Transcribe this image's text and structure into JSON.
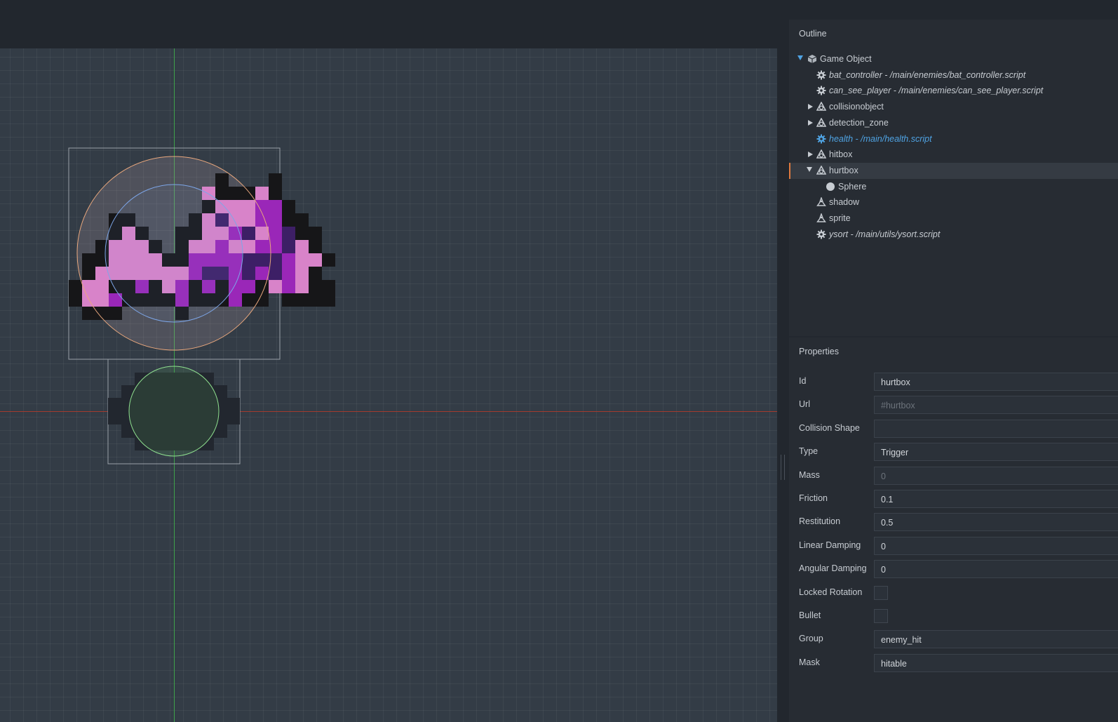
{
  "outline": {
    "title": "Outline",
    "items": [
      {
        "label": "Game Object",
        "kind": "game-object",
        "expanded": true
      },
      {
        "label": "bat_controller - /main/enemies/bat_controller.script",
        "kind": "script"
      },
      {
        "label": "can_see_player - /main/enemies/can_see_player.script",
        "kind": "script"
      },
      {
        "label": "collisionobject",
        "kind": "collision",
        "expandable": true
      },
      {
        "label": "detection_zone",
        "kind": "collision",
        "expandable": true
      },
      {
        "label": "health - /main/health.script",
        "kind": "script",
        "active": true
      },
      {
        "label": "hitbox",
        "kind": "collision",
        "expandable": true
      },
      {
        "label": "hurtbox",
        "kind": "collision",
        "expanded": true,
        "selected": true
      },
      {
        "label": "Sphere",
        "kind": "shape"
      },
      {
        "label": "shadow",
        "kind": "sprite"
      },
      {
        "label": "sprite",
        "kind": "sprite"
      },
      {
        "label": "ysort - /main/utils/ysort.script",
        "kind": "script"
      }
    ]
  },
  "properties": {
    "title": "Properties",
    "rows": [
      {
        "label": "Id",
        "value": "hurtbox",
        "type": "text"
      },
      {
        "label": "Url",
        "value": "#hurtbox",
        "type": "readonly"
      },
      {
        "label": "Collision Shape",
        "value": "",
        "type": "text"
      },
      {
        "label": "Type",
        "value": "Trigger",
        "type": "text"
      },
      {
        "label": "Mass",
        "value": "0",
        "type": "readonly"
      },
      {
        "label": "Friction",
        "value": "0.1",
        "type": "text"
      },
      {
        "label": "Restitution",
        "value": "0.5",
        "type": "text"
      },
      {
        "label": "Linear Damping",
        "value": "0",
        "type": "text"
      },
      {
        "label": "Angular Damping",
        "value": "0",
        "type": "text"
      },
      {
        "label": "Locked Rotation",
        "value": false,
        "type": "checkbox"
      },
      {
        "label": "Bullet",
        "value": false,
        "type": "checkbox"
      },
      {
        "label": "Group",
        "value": "enemy_hit",
        "type": "text"
      },
      {
        "label": "Mask",
        "value": "hitable",
        "type": "text"
      }
    ]
  },
  "colors": {
    "accent": "#4fa3e3",
    "selection_marker": "#e07a3f",
    "y_axis": "#3fa24a",
    "x_axis": "#a33a2e",
    "hitbox_circle": "#e8a77d",
    "hurtbox_circle": "#7da6e8",
    "shadow_circle": "#8fe08f",
    "bat_pink": "#d883c9",
    "bat_purple": "#9a27b8",
    "bat_dark": "#3d1f66",
    "bat_black": "#161618"
  },
  "icons": {
    "game_object": "cube-icon",
    "script": "gear-icon",
    "collision": "collision-object-icon",
    "shape": "circle-icon",
    "sprite": "sprite-icon"
  }
}
